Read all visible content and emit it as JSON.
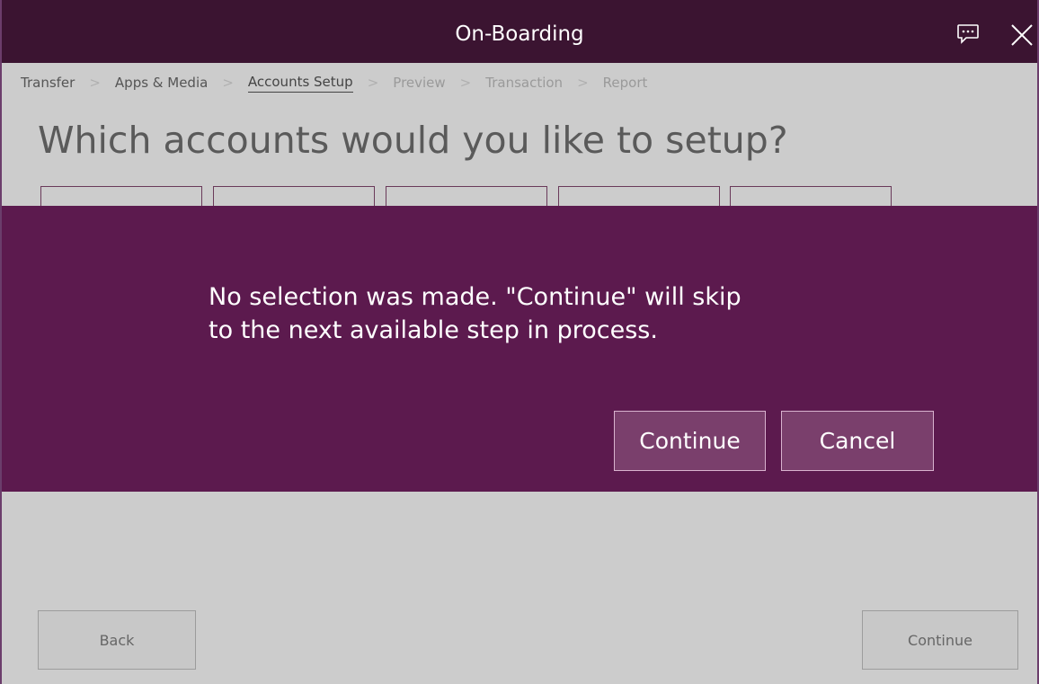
{
  "window": {
    "title": "On-Boarding"
  },
  "icons": {
    "feedback": "chat-feedback-icon",
    "close": "close-icon"
  },
  "breadcrumb": {
    "steps": [
      {
        "label": "Transfer",
        "state": "done"
      },
      {
        "label": "Apps & Media",
        "state": "done"
      },
      {
        "label": "Accounts Setup",
        "state": "active"
      },
      {
        "label": "Preview",
        "state": "pending"
      },
      {
        "label": "Transaction",
        "state": "pending"
      },
      {
        "label": "Report",
        "state": "pending"
      }
    ],
    "separator": ">"
  },
  "main": {
    "heading": "Which accounts would you like to setup?"
  },
  "dialog": {
    "line1": "No selection was made. \"Continue\" will skip",
    "line2": "to the next available step in process.",
    "continue_label": "Continue",
    "cancel_label": "Cancel"
  },
  "footer": {
    "back_label": "Back",
    "continue_label": "Continue"
  },
  "colors": {
    "titlebar": "#3b1431",
    "dialog_background": "#5c1a4e",
    "dialog_button": "#7a3f6c",
    "page_background": "#cccccc"
  }
}
